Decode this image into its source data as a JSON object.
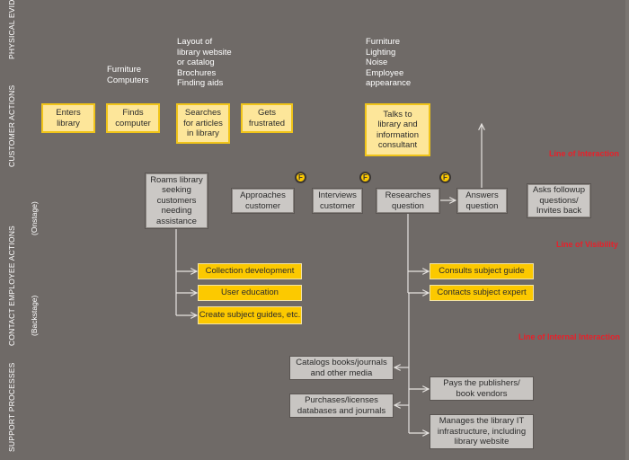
{
  "lanes": {
    "physical_evidence": "PHYSICAL EVIDENCE",
    "customer_actions": "CUSTOMER ACTIONS",
    "contact_employee_actions": "CONTACT EMPLOYEE ACTIONS",
    "onstage": "(Onstage)",
    "backstage": "(Backstage)",
    "support_processes": "SUPPORT PROCESSES"
  },
  "physical_evidence": [
    {
      "lines": [
        "Furniture",
        "Computers"
      ]
    },
    {
      "lines": [
        "Layout of",
        "library website",
        "or catalog",
        "Brochures",
        "Finding aids"
      ]
    },
    {
      "lines": [
        "Furniture",
        "Lighting",
        "Noise",
        "Employee",
        "appearance"
      ]
    }
  ],
  "customer_actions": [
    {
      "lines": [
        "Enters",
        "library"
      ]
    },
    {
      "lines": [
        "Finds",
        "computer"
      ]
    },
    {
      "lines": [
        "Searches",
        "for articles",
        "in library"
      ]
    },
    {
      "lines": [
        "Gets",
        "frustrated"
      ]
    },
    {
      "lines": [
        "Talks to",
        "library and",
        "information",
        "consultant"
      ]
    }
  ],
  "onstage_actions": [
    {
      "lines": [
        "Roams library",
        "seeking",
        "customers",
        "needing",
        "assistance"
      ]
    },
    {
      "lines": [
        "Approaches",
        "customer"
      ]
    },
    {
      "lines": [
        "Interviews",
        "customer"
      ]
    },
    {
      "lines": [
        "Researches",
        "question"
      ]
    },
    {
      "lines": [
        "Answers",
        "question"
      ]
    },
    {
      "lines": [
        "Asks followup",
        "questions/",
        "Invites back"
      ]
    }
  ],
  "fail_points": [
    {
      "label": "F"
    },
    {
      "label": "F"
    },
    {
      "label": "F"
    }
  ],
  "backstage_actions": [
    {
      "lines": [
        "Collection development"
      ]
    },
    {
      "lines": [
        "User education"
      ]
    },
    {
      "lines": [
        "Create subject guides, etc."
      ]
    },
    {
      "lines": [
        "Consults subject guide"
      ]
    },
    {
      "lines": [
        "Contacts subject expert"
      ]
    }
  ],
  "support_processes": [
    {
      "lines": [
        "Catalogs books/journals",
        "and other media"
      ]
    },
    {
      "lines": [
        "Pays the publishers/",
        "book vendors"
      ]
    },
    {
      "lines": [
        "Purchases/licenses",
        "databases and journals"
      ]
    },
    {
      "lines": [
        "Manages the library IT",
        "infrastructure, including",
        "library website"
      ]
    }
  ],
  "divider_lines": {
    "interaction": "Line of Interaction",
    "visibility": "Line of Visibility",
    "internal_interaction": "Line of Internal Interaction"
  },
  "colors": {
    "background": "#6f6a67",
    "customer_box": "#fde69a",
    "customer_border": "#f0c419",
    "backstage_box": "#fcc900",
    "onstage_box": "#cbc8c5",
    "line_label": "#e8202a",
    "connector": "#e6e3e0"
  }
}
